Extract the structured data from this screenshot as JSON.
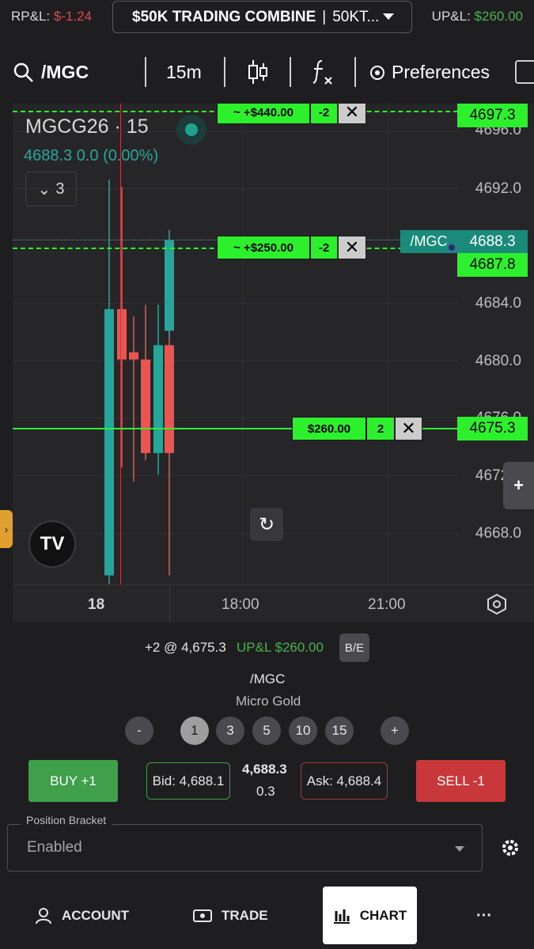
{
  "topbar": {
    "rpl_label": "RP&L:",
    "rpl_value": "$-1.24",
    "account_name": "$50K TRADING COMBINE",
    "account_sep": "|",
    "account_id": "50KT...",
    "upl_label": "UP&L:",
    "upl_value": "$260.00"
  },
  "toolbar": {
    "symbol": "/MGC",
    "interval": "15m",
    "preferences": "Preferences"
  },
  "chart": {
    "legend_title": "MGCG26 · 15",
    "legend_price": "4688.3  0.0 (0.00%)",
    "legend_collapse_count": "3",
    "price_axis": [
      "4696.0",
      "4692.0",
      "4688.3",
      "4684.0",
      "4680.0",
      "4676.0",
      "4672.0",
      "4668.0"
    ],
    "time_axis": [
      "18",
      "18:00",
      "21:00"
    ],
    "symbol_tag": "/MGC",
    "current_price": "4688.3",
    "orders": [
      {
        "label": "~ +$440.00",
        "qty": "-2",
        "price": "4697.3"
      },
      {
        "label": "~ +$250.00",
        "qty": "-2",
        "price": "4687.8"
      },
      {
        "label": "$260.00",
        "qty": "2",
        "price": "4675.3"
      }
    ],
    "colors": {
      "up": "#26a69a",
      "down": "#ef5350",
      "order": "#2df02d"
    }
  },
  "chart_data": {
    "type": "candlestick",
    "title": "MGCG26 · 15",
    "x": [
      "c1",
      "c2",
      "c3",
      "c4",
      "c5",
      "c6",
      "c7"
    ],
    "open": [
      4665.0,
      4683.5,
      4680.5,
      4680.0,
      4673.5,
      4681.0,
      4682.0
    ],
    "high": [
      4692.5,
      4692.0,
      4683.0,
      4683.8,
      4683.8,
      4684.0,
      4689.0
    ],
    "low": [
      4663.0,
      4672.5,
      4671.5,
      4673.0,
      4672.0,
      4665.0,
      4681.5
    ],
    "close": [
      4683.5,
      4680.0,
      4680.0,
      4673.5,
      4681.0,
      4673.5,
      4688.3
    ],
    "ylim": [
      4664.0,
      4698.0
    ],
    "grid": true
  },
  "position": {
    "summary": "+2 @ 4,675.3",
    "upl": "UP&L $260.00",
    "be_label": "B/E",
    "symbol": "/MGC",
    "name": "Micro Gold"
  },
  "quantities": {
    "minus": "-",
    "plus": "+",
    "options": [
      "1",
      "3",
      "5",
      "10",
      "15"
    ]
  },
  "order_entry": {
    "buy": "BUY +1",
    "sell": "SELL -1",
    "bid": "Bid: 4,688.1",
    "ask": "Ask: 4,688.4",
    "last": "4,688.3",
    "spread": "0.3"
  },
  "bracket": {
    "legend": "Position Bracket",
    "value": "Enabled"
  },
  "nav": {
    "account": "ACCOUNT",
    "trade": "TRADE",
    "chart": "CHART",
    "more": "···"
  }
}
